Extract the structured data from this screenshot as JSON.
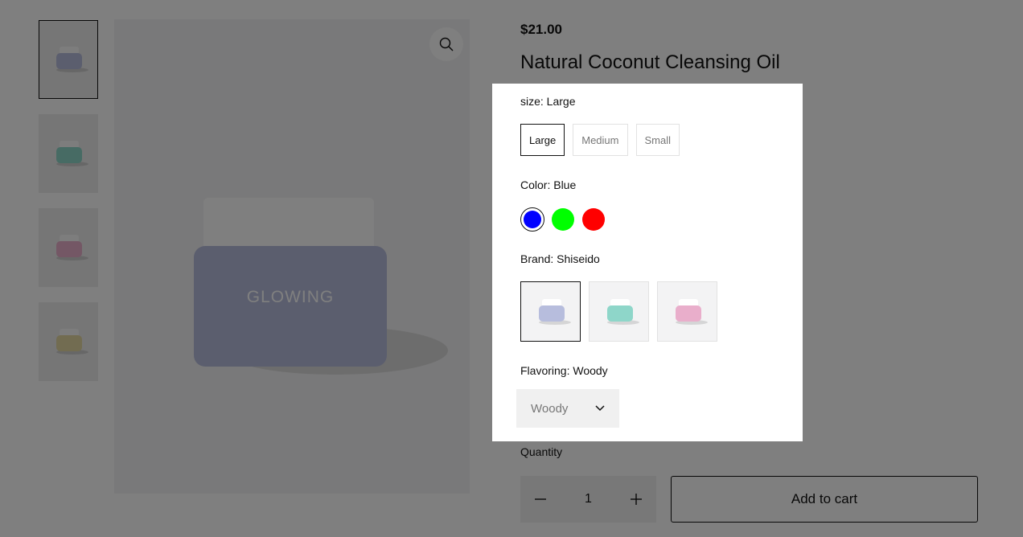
{
  "product": {
    "price": "$21.00",
    "title": "Natural Coconut Cleansing Oil",
    "jar_brand_text": "GLOWING"
  },
  "gallery": {
    "thumbnails": [
      {
        "color": "#b7bddd",
        "active": true
      },
      {
        "color": "#8ed6c9",
        "active": false
      },
      {
        "color": "#e9aecb",
        "active": false
      },
      {
        "color": "#e5d9a2",
        "active": false
      }
    ],
    "zoom_icon": "zoom-icon"
  },
  "options": {
    "size": {
      "label": "size: Large",
      "values": [
        "Large",
        "Medium",
        "Small"
      ],
      "selected": "Large"
    },
    "color": {
      "label": "Color: Blue",
      "swatches": [
        {
          "name": "Blue",
          "hex": "#0000ff"
        },
        {
          "name": "Green",
          "hex": "#00ff00"
        },
        {
          "name": "Red",
          "hex": "#ff0000"
        }
      ],
      "selected": "Blue"
    },
    "brand": {
      "label": "Brand: Shiseido",
      "images": [
        {
          "color": "#b7bddd"
        },
        {
          "color": "#8ed6c9"
        },
        {
          "color": "#e9aecb"
        }
      ],
      "selected_index": 0
    },
    "flavoring": {
      "label": "Flavoring: Woody",
      "value": "Woody",
      "icon": "chevron-down-icon"
    }
  },
  "purchase": {
    "quantity_label": "Quantity",
    "quantity": "1",
    "minus_icon": "minus-icon",
    "plus_icon": "plus-icon",
    "add_to_cart": "Add to cart"
  },
  "theme": {
    "overlay": "rgba(0,0,0,0.5)",
    "text": "#111111"
  }
}
